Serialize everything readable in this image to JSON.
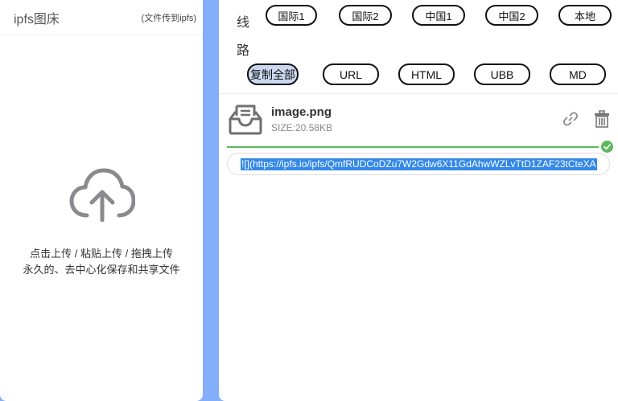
{
  "left": {
    "title": "ipfs图床",
    "subtitle": "(文件传到ipfs)",
    "hint_line1": "点击上传 / 粘贴上传 / 拖拽上传",
    "hint_line2": "永久的、去中心化保存和共享文件"
  },
  "route": {
    "label_top": "线",
    "label_bottom": "路",
    "buttons": [
      "国际1",
      "国际2",
      "中国1",
      "中国2",
      "本地"
    ]
  },
  "formats": {
    "buttons": [
      "复制全部",
      "URL",
      "HTML",
      "UBB",
      "MD"
    ],
    "active": "复制全部"
  },
  "file": {
    "name": "image.png",
    "size": "SIZE:20.58KB",
    "upload_progress": 1.0,
    "link": "![](https://ipfs.io/ipfs/QmfRUDCoDZu7W2Gdw6X11GdAhwWZLvTtD1ZAF23tCteXA"
  },
  "colors": {
    "background": "#82aefa",
    "active_pill": "#c9d8f0",
    "success": "#5cb85c",
    "selection": "#3388e8"
  },
  "icons": {
    "upload": "cloud-upload-icon",
    "file": "inbox-icon",
    "link": "link-icon",
    "delete": "trash-icon",
    "done": "check-circle-icon"
  }
}
